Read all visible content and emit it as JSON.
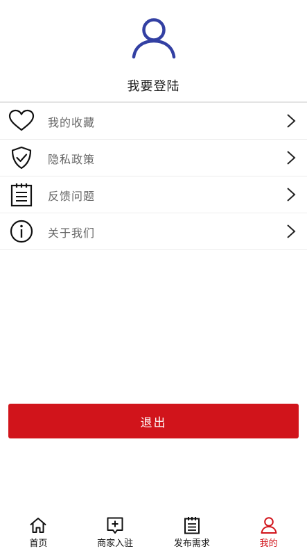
{
  "profile": {
    "login_text": "我要登陆"
  },
  "menu": {
    "items": [
      {
        "label": "我的收藏",
        "icon": "heart-icon"
      },
      {
        "label": "隐私政策",
        "icon": "shield-check-icon"
      },
      {
        "label": "反馈问题",
        "icon": "notepad-icon"
      },
      {
        "label": "关于我们",
        "icon": "info-icon"
      }
    ]
  },
  "logout": {
    "label": "退出"
  },
  "tabbar": {
    "items": [
      {
        "label": "首页",
        "icon": "home-icon"
      },
      {
        "label": "商家入驻",
        "icon": "merchant-add-icon"
      },
      {
        "label": "发布需求",
        "icon": "document-icon"
      },
      {
        "label": "我的",
        "icon": "user-icon",
        "active": true
      }
    ]
  },
  "colors": {
    "accent": "#d1141b",
    "avatar": "#3340a3"
  }
}
